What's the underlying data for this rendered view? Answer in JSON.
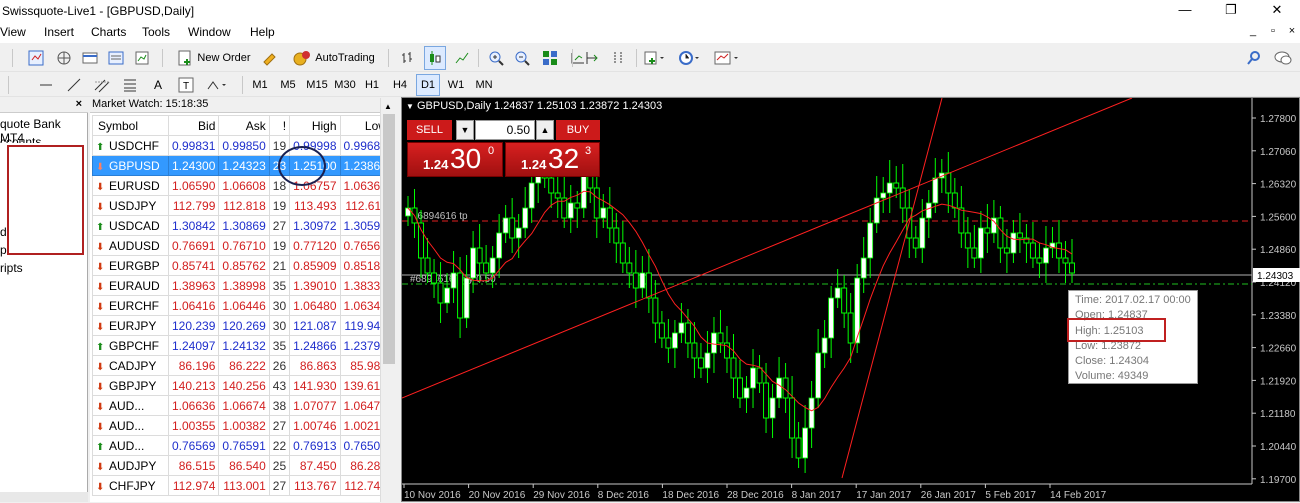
{
  "window": {
    "title": "Swissquote-Live1 - [GBPUSD,Daily]",
    "minimize": "—",
    "restore": "❐",
    "close": "✕"
  },
  "menu": [
    "View",
    "Insert",
    "Charts",
    "Tools",
    "Window",
    "Help"
  ],
  "mdi": {
    "minimize": "_",
    "restore": "▫",
    "close": "×"
  },
  "toolbar": {
    "new_order": "New Order",
    "autotrading": "AutoTrading"
  },
  "timeframes": [
    "M1",
    "M5",
    "M15",
    "M30",
    "H1",
    "H4",
    "D1",
    "W1",
    "MN"
  ],
  "timeframe_active": "D1",
  "navigator": {
    "close": "×",
    "items": [
      "quote Bank MT4",
      "ccounts",
      "d",
      "p",
      "ripts"
    ]
  },
  "market_watch": {
    "header": "Market Watch: 15:18:35",
    "close": "×",
    "columns": [
      "Symbol",
      "Bid",
      "Ask",
      "!",
      "High",
      "Low"
    ],
    "rows": [
      {
        "symbol": "USDCHF",
        "dir": "up",
        "bid": "0.99831",
        "ask": "0.99850",
        "spread": "19",
        "high": "0.99998",
        "low": "0.99681",
        "color": "#1f2fcc"
      },
      {
        "symbol": "GBPUSD",
        "dir": "dn",
        "bid": "1.24300",
        "ask": "1.24323",
        "spread": "23",
        "high": "1.25100",
        "low": "1.23869",
        "color": "#ffffff",
        "selected": true
      },
      {
        "symbol": "EURUSD",
        "dir": "dn",
        "bid": "1.06590",
        "ask": "1.06608",
        "spread": "18",
        "high": "1.06757",
        "low": "1.06363",
        "color": "#d21f1f"
      },
      {
        "symbol": "USDJPY",
        "dir": "dn",
        "bid": "112.799",
        "ask": "112.818",
        "spread": "19",
        "high": "113.493",
        "low": "112.611",
        "color": "#d21f1f"
      },
      {
        "symbol": "USDCAD",
        "dir": "up",
        "bid": "1.30842",
        "ask": "1.30869",
        "spread": "27",
        "high": "1.30972",
        "low": "1.30591",
        "color": "#1f2fcc"
      },
      {
        "symbol": "AUDUSD",
        "dir": "dn",
        "bid": "0.76691",
        "ask": "0.76710",
        "spread": "19",
        "high": "0.77120",
        "low": "0.76565",
        "color": "#d21f1f"
      },
      {
        "symbol": "EURGBP",
        "dir": "dn",
        "bid": "0.85741",
        "ask": "0.85762",
        "spread": "21",
        "high": "0.85909",
        "low": "0.85187",
        "color": "#d21f1f"
      },
      {
        "symbol": "EURAUD",
        "dir": "dn",
        "bid": "1.38963",
        "ask": "1.38998",
        "spread": "35",
        "high": "1.39010",
        "low": "1.38337",
        "color": "#d21f1f"
      },
      {
        "symbol": "EURCHF",
        "dir": "dn",
        "bid": "1.06416",
        "ask": "1.06446",
        "spread": "30",
        "high": "1.06480",
        "low": "1.06340",
        "color": "#d21f1f"
      },
      {
        "symbol": "EURJPY",
        "dir": "dn",
        "bid": "120.239",
        "ask": "120.269",
        "spread": "30",
        "high": "121.087",
        "low": "119.943",
        "color": "#1f2fcc"
      },
      {
        "symbol": "GBPCHF",
        "dir": "up",
        "bid": "1.24097",
        "ask": "1.24132",
        "spread": "35",
        "high": "1.24866",
        "low": "1.23795",
        "color": "#1f2fcc"
      },
      {
        "symbol": "CADJPY",
        "dir": "dn",
        "bid": "86.196",
        "ask": "86.222",
        "spread": "26",
        "high": "86.863",
        "low": "85.985",
        "color": "#d21f1f"
      },
      {
        "symbol": "GBPJPY",
        "dir": "dn",
        "bid": "140.213",
        "ask": "140.256",
        "spread": "43",
        "high": "141.930",
        "low": "139.616",
        "color": "#d21f1f"
      },
      {
        "symbol": "AUD...",
        "dir": "dn",
        "bid": "1.06636",
        "ask": "1.06674",
        "spread": "38",
        "high": "1.07077",
        "low": "1.06477",
        "color": "#d21f1f"
      },
      {
        "symbol": "AUD...",
        "dir": "dn",
        "bid": "1.00355",
        "ask": "1.00382",
        "spread": "27",
        "high": "1.00746",
        "low": "1.00217",
        "color": "#d21f1f"
      },
      {
        "symbol": "AUD...",
        "dir": "up",
        "bid": "0.76569",
        "ask": "0.76591",
        "spread": "22",
        "high": "0.76913",
        "low": "0.76504",
        "color": "#1f2fcc"
      },
      {
        "symbol": "AUDJPY",
        "dir": "dn",
        "bid": "86.515",
        "ask": "86.540",
        "spread": "25",
        "high": "87.450",
        "low": "86.288",
        "color": "#d21f1f"
      },
      {
        "symbol": "CHFJPY",
        "dir": "dn",
        "bid": "112.974",
        "ask": "113.001",
        "spread": "27",
        "high": "113.767",
        "low": "112.748",
        "color": "#d21f1f"
      }
    ]
  },
  "chart": {
    "header": "GBPUSD,Daily  1.24837 1.25103 1.23872 1.24303",
    "trade": {
      "sell": "SELL",
      "buy": "BUY",
      "lot": "0.50",
      "sell_small": "1.24",
      "sell_big": "30",
      "sell_sup": "0",
      "buy_small": "1.24",
      "buy_big": "32",
      "buy_sup": "3"
    },
    "tp_label": "#6894616 tp",
    "buy_label": "#6894616 buy 0.50",
    "price_labels": [
      "1.27800",
      "1.27060",
      "1.26320",
      "1.25600",
      "1.24860",
      "1.24303",
      "1.24120",
      "1.23380",
      "1.22660",
      "1.21920",
      "1.21180",
      "1.20440",
      "1.19700"
    ],
    "current_price": "1.24303",
    "date_labels": [
      "10 Nov 2016",
      "20 Nov 2016",
      "29 Nov 2016",
      "8 Dec 2016",
      "18 Dec 2016",
      "28 Dec 2016",
      "8 Jan 2017",
      "17 Jan 2017",
      "26 Jan 2017",
      "5 Feb 2017",
      "14 Feb 2017"
    ],
    "tooltip": [
      "Time: 2017.02.17 00:00",
      "Open: 1.24837",
      "High: 1.25103",
      "Low: 1.23872",
      "Close: 1.24304",
      "Volume: 49349"
    ],
    "colors": {
      "bull": "#00ff00",
      "bear": "#00ff00",
      "ma": "#ff2020",
      "trend": "#ff2020"
    }
  }
}
